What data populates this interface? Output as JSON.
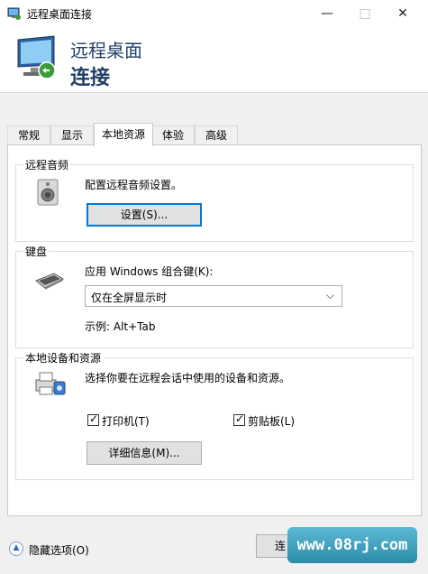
{
  "window": {
    "title": "远程桌面连接"
  },
  "window_controls": {
    "minimize": "—",
    "maximize": "□",
    "close": "✕"
  },
  "header": {
    "line1": "远程桌面",
    "line2": "连接"
  },
  "tabs": [
    {
      "label": "常规"
    },
    {
      "label": "显示"
    },
    {
      "label": "本地资源"
    },
    {
      "label": "体验"
    },
    {
      "label": "高级"
    }
  ],
  "active_tab": "本地资源",
  "remote_audio": {
    "label": "远程音频",
    "description": "配置远程音频设置。",
    "settings_button": "设置(S)..."
  },
  "keyboard": {
    "label": "键盘",
    "apply_label": "应用 Windows 组合键(K):",
    "selected": "仅在全屏显示时",
    "example": "示例: Alt+Tab"
  },
  "local_devices": {
    "label": "本地设备和资源",
    "description": "选择你要在远程会话中使用的设备和资源。",
    "printer": {
      "label": "打印机(T)",
      "checked": true
    },
    "clipboard": {
      "label": "剪贴板(L)",
      "checked": true
    },
    "details_button": "详细信息(M)..."
  },
  "footer": {
    "hide_options": "隐藏选项(O)",
    "connect_button": "连"
  },
  "watermark": "www.08rj.com",
  "colors": {
    "accent": "#0078d7",
    "header_text": "#1f3f66"
  }
}
